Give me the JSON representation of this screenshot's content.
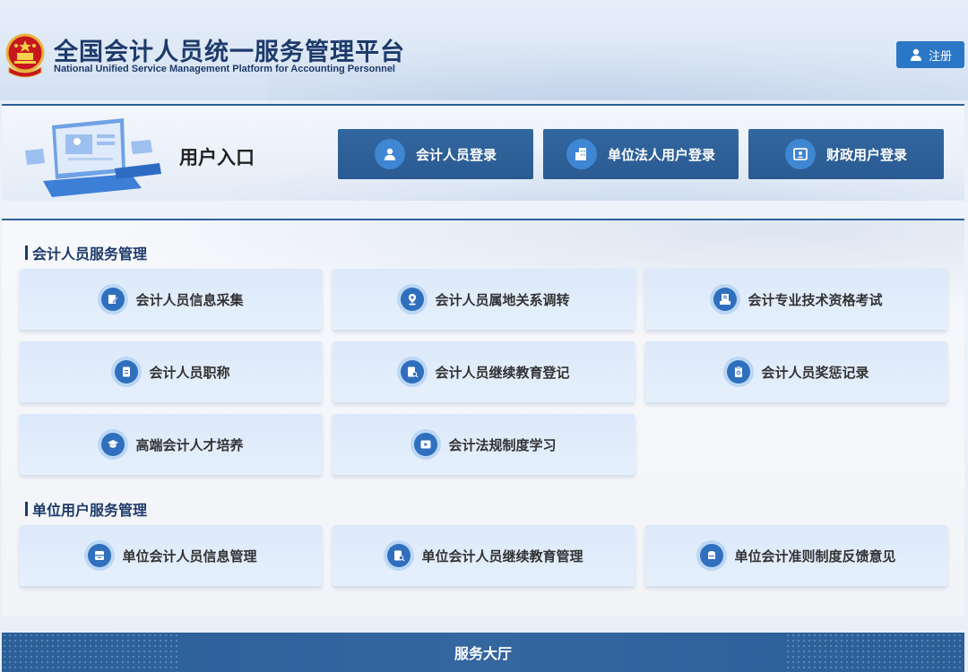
{
  "header": {
    "title": "全国会计人员统一服务管理平台",
    "subtitle": "National Unified Service Management Platform for Accounting Personnel",
    "register_label": "注册"
  },
  "login": {
    "entry_title": "用户入口",
    "buttons": [
      {
        "label": "会计人员登录",
        "icon": "user-icon"
      },
      {
        "label": "单位法人用户登录",
        "icon": "building-icon"
      },
      {
        "label": "财政用户登录",
        "icon": "id-card-icon"
      }
    ]
  },
  "sections": [
    {
      "title": "会计人员服务管理",
      "items": [
        {
          "label": "会计人员信息采集",
          "icon": "edit-form-icon"
        },
        {
          "label": "会计人员属地关系调转",
          "icon": "location-icon"
        },
        {
          "label": "会计专业技术资格考试",
          "icon": "exam-icon"
        },
        {
          "label": "会计人员职称",
          "icon": "document-icon"
        },
        {
          "label": "会计人员继续教育登记",
          "icon": "search-document-icon"
        },
        {
          "label": "会计人员奖惩记录",
          "icon": "clipboard-icon"
        },
        {
          "label": "高端会计人才培养",
          "icon": "graduation-cap-icon"
        },
        {
          "label": "会计法规制度学习",
          "icon": "play-icon"
        }
      ]
    },
    {
      "title": "单位用户服务管理",
      "items": [
        {
          "label": "单位会计人员信息管理",
          "icon": "database-icon"
        },
        {
          "label": "单位会计人员继续教育管理",
          "icon": "search-document-icon"
        },
        {
          "label": "单位会计准则制度反馈意见",
          "icon": "chat-icon"
        }
      ]
    }
  ],
  "footer": {
    "service_hall_label": "服务大厅"
  },
  "colors": {
    "primary": "#2b5f98",
    "accent": "#2a77c7",
    "title": "#1d3a6b",
    "card_bg": "#dce9fa"
  }
}
